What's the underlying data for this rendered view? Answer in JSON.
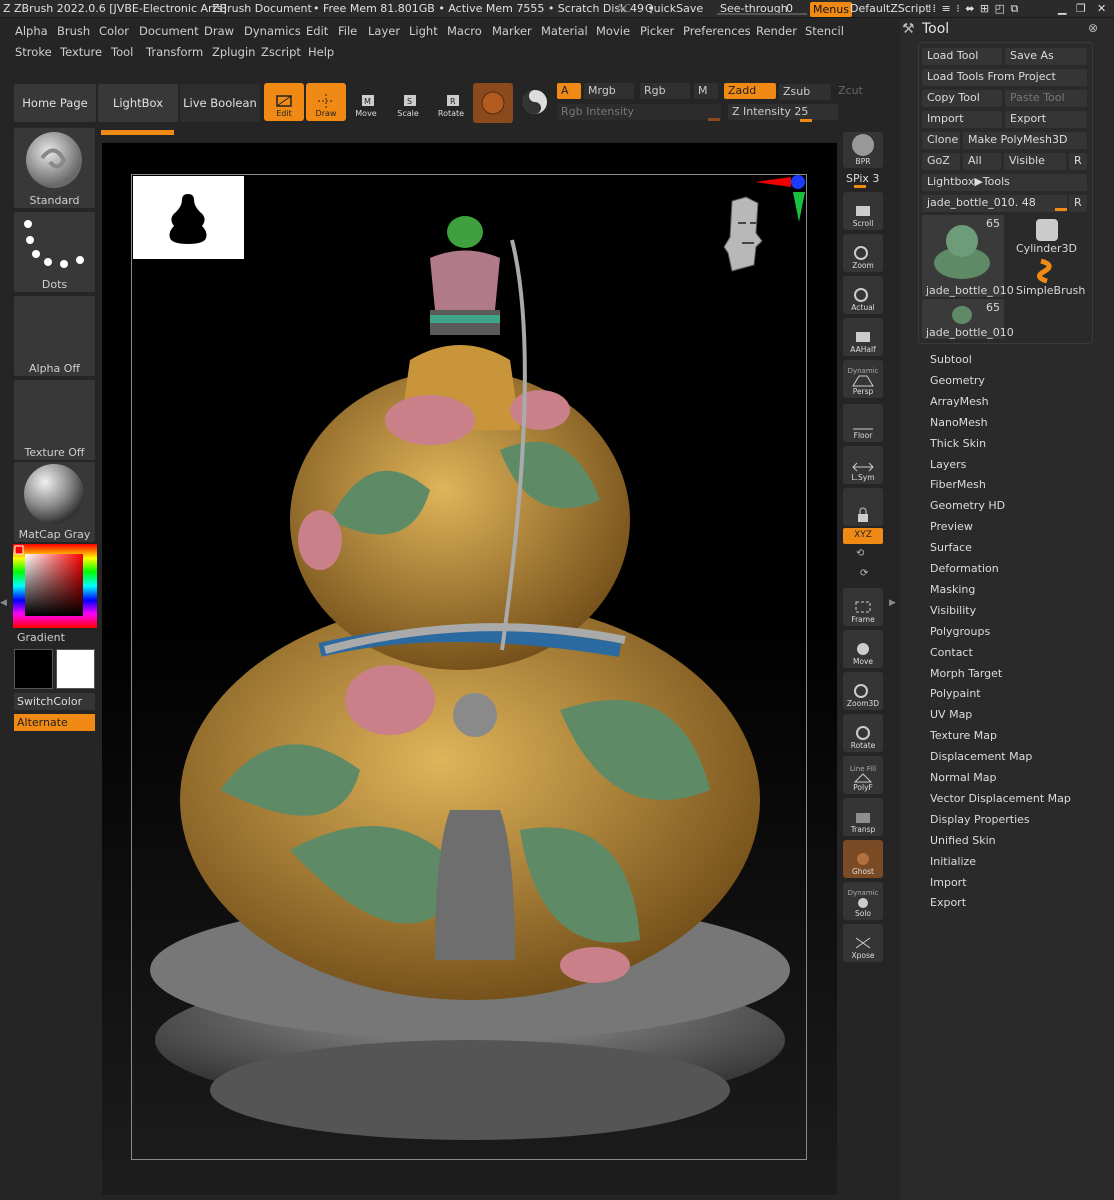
{
  "title_bar": {
    "app": "ZBrush 2022.0.6 [JVBE-Electronic Arts]",
    "document": "ZBrush Document",
    "stats": "• Free Mem 81.801GB • Active Mem 7555 • Scratch Disk 49 •",
    "ac": "AC",
    "quicksave": "QuickSave",
    "seethrough_label": "See-through",
    "seethrough_value": "0",
    "menus": "Menus",
    "script": "DefaultZScript"
  },
  "menubar": {
    "row1": [
      "Alpha",
      "Brush",
      "Color",
      "Document",
      "Draw",
      "Dynamics",
      "Edit",
      "File",
      "Layer",
      "Light",
      "Macro",
      "Marker",
      "Material",
      "Movie",
      "Picker",
      "Preferences",
      "Render",
      "Stencil"
    ],
    "row2": [
      "Stroke",
      "Texture",
      "Tool",
      "Transform",
      "Zplugin",
      "Zscript",
      "Help"
    ]
  },
  "shelf": {
    "tabs": [
      "Home Page",
      "LightBox",
      "Live Boolean"
    ],
    "tools": [
      "Edit",
      "Draw",
      "Move",
      "Scale",
      "Rotate"
    ],
    "a": "A",
    "mrgb": "Mrgb",
    "rgb": "Rgb",
    "m": "M",
    "zadd": "Zadd",
    "zsub": "Zsub",
    "zcut": "Zcut",
    "rgb_intensity": "Rgb Intensity",
    "z_intensity": "Z Intensity 25"
  },
  "left_shelf": {
    "brush": "Standard",
    "stroke": "Dots",
    "alpha": "Alpha Off",
    "texture": "Texture Off",
    "material": "MatCap Gray",
    "gradient": "Gradient",
    "switch_color": "SwitchColor",
    "alternate": "Alternate"
  },
  "right_shelf": {
    "bpr": "BPR",
    "spix": "SPix 3",
    "items": [
      "Scroll",
      "Zoom",
      "Actual",
      "AAHalf",
      "Persp",
      "Floor",
      "L.Sym",
      "",
      "XYZ",
      "Frame",
      "Move",
      "Zoom3D",
      "Rotate",
      "PolyF",
      "Transp",
      "Ghost",
      "Solo",
      "Xpose"
    ],
    "dynamic": "Dynamic",
    "line_fill": "Line Fill",
    "dynamic2": "Dynamic"
  },
  "tool_panel": {
    "title": "Tool",
    "buttons": {
      "load_tool": "Load Tool",
      "save_as": "Save As",
      "load_from_project": "Load Tools From Project",
      "copy_tool": "Copy Tool",
      "paste_tool": "Paste Tool",
      "import": "Import",
      "export": "Export",
      "clone": "Clone",
      "make_polymesh": "Make PolyMesh3D",
      "goz": "GoZ",
      "all": "All",
      "visible": "Visible",
      "r": "R",
      "lightbox_tools": "Lightbox▶Tools",
      "tool_slider": "jade_bottle_010. 48"
    },
    "thumbs": [
      {
        "label": "jade_bottle_010",
        "count": "65"
      },
      {
        "label": "Cylinder3D",
        "count": ""
      },
      {
        "label": "SimpleBrush",
        "count": ""
      },
      {
        "label": "jade_bottle_010",
        "count": "65"
      }
    ],
    "subpalettes": [
      "Subtool",
      "Geometry",
      "ArrayMesh",
      "NanoMesh",
      "Thick Skin",
      "Layers",
      "FiberMesh",
      "Geometry HD",
      "Preview",
      "Surface",
      "Deformation",
      "Masking",
      "Visibility",
      "Polygroups",
      "Contact",
      "Morph Target",
      "Polypaint",
      "UV Map",
      "Texture Map",
      "Displacement Map",
      "Normal Map",
      "Vector Displacement Map",
      "Display Properties",
      "Unified Skin",
      "Initialize",
      "Import",
      "Export"
    ]
  },
  "colors": {
    "accent": "#f08a14",
    "background": "#252525",
    "jade_green": "#5f8a66",
    "gold": "#c9953b",
    "pink": "#c98089"
  }
}
